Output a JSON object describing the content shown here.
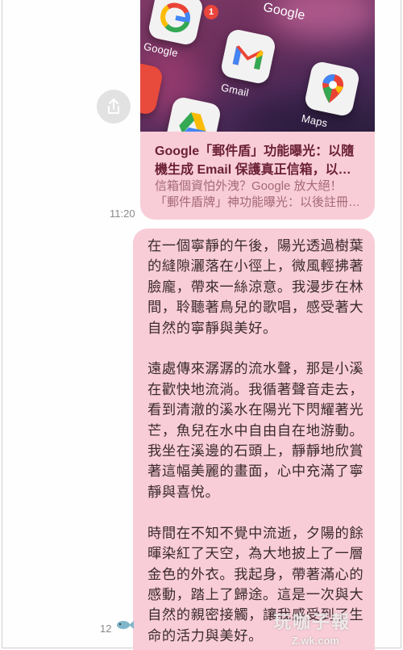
{
  "link_preview": {
    "title": "Google「郵件盾」功能曝光：以隨機生成 Email 保護真正信箱，以…",
    "desc_line1": "信箱個資怕外洩？Google 放大絕！",
    "desc_line2": "「郵件盾牌」神功能曝光：以後註冊…",
    "apps": [
      {
        "name": "Google",
        "icon": "google-g-icon",
        "badge": "1"
      },
      {
        "name": "Gmail",
        "icon": "gmail-icon"
      },
      {
        "name": "Maps",
        "icon": "maps-pin-icon"
      },
      {
        "name": "Drive",
        "icon": "drive-icon"
      }
    ],
    "thumb_header": "Google"
  },
  "share": {
    "icon": "share-icon"
  },
  "messages": [
    {
      "time": "11:20"
    },
    {
      "time": "12"
    }
  ],
  "bubble": {
    "text": "在一個寧靜的午後，陽光透過樹葉的縫隙灑落在小徑上，微風輕拂著臉龐，帶來一絲涼意。我漫步在林間，聆聽著鳥兒的歌唱，感受著大自然的寧靜與美好。\n\n遠處傳來潺潺的流水聲，那是小溪在歡快地流淌。我循著聲音走去，看到清澈的溪水在陽光下閃耀著光芒，魚兒在水中自由自在地游動。我坐在溪邊的石頭上，靜靜地欣賞著這幅美麗的畫面，心中充滿了寧靜與喜悅。\n\n時間在不知不覺中流逝，夕陽的餘暉染紅了天空，為大地披上了一層金色的外衣。我起身，帶著滿心的感動，踏上了歸途。這是一次與大自然的親密接觸，讓我感受到了生命的活力與美好。"
  },
  "watermark": {
    "text": "玩咖子報",
    "url": "Z.wk.com"
  },
  "colors": {
    "bubble": "#f9cdd8",
    "title": "#6b2036",
    "desc": "#a46877",
    "timestamp": "#8a8a8a"
  }
}
